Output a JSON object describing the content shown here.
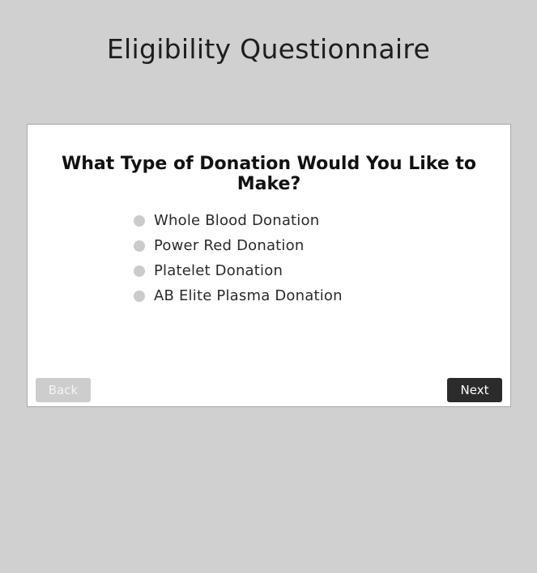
{
  "page": {
    "title": "Eligibility Questionnaire"
  },
  "question": {
    "text": "What Type of Donation Would You Like to Make?",
    "options": [
      {
        "label": "Whole Blood Donation",
        "selected": false
      },
      {
        "label": "Power Red Donation",
        "selected": false
      },
      {
        "label": "Platelet Donation",
        "selected": false
      },
      {
        "label": "AB Elite Plasma Donation",
        "selected": false
      }
    ]
  },
  "nav": {
    "back_label": "Back",
    "next_label": "Next",
    "back_enabled": false
  },
  "colors": {
    "background": "#d0d0d0",
    "card": "#ffffff",
    "radio": "#cbcbcb",
    "next_button": "#2b2b2b",
    "back_button_disabled": "#cdcdcd"
  }
}
